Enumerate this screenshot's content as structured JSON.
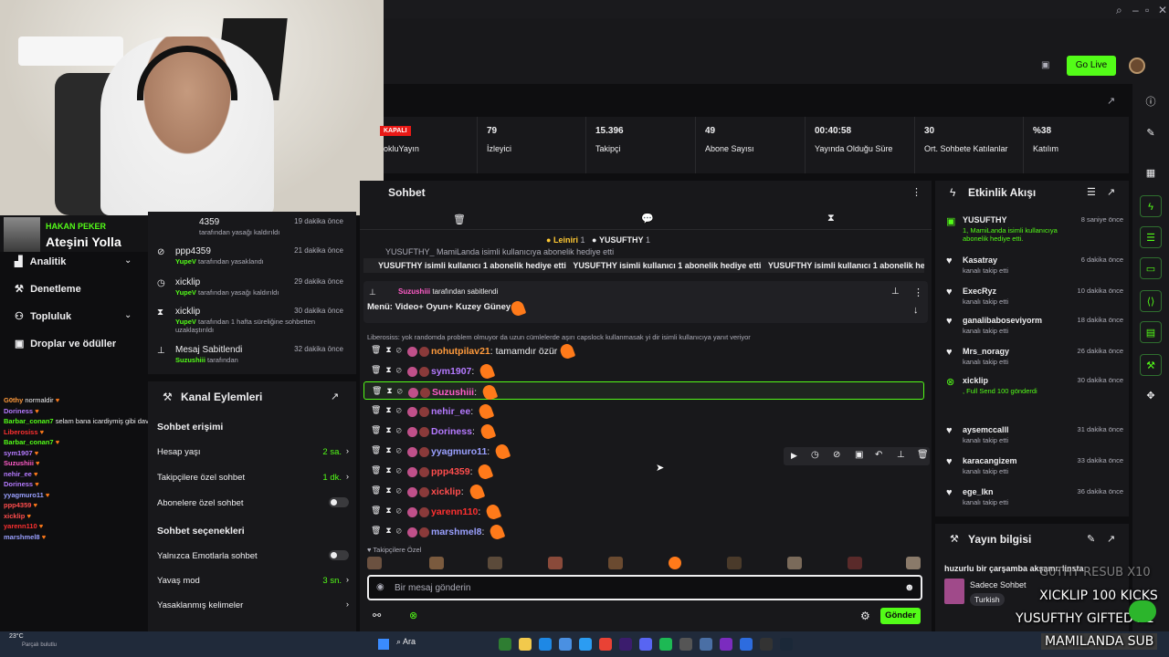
{
  "colors": {
    "accent": "#53fc18",
    "bg": "#0e0e10",
    "panel": "#18181b",
    "live": "#e91916",
    "heart": "#ff7a1a"
  },
  "header": {
    "go_live": "Go Live"
  },
  "webcam": {
    "alert_name": "HAKAN PEKER",
    "alert_message": "Ateşini Yolla"
  },
  "sidebar": {
    "items": [
      {
        "label": "Analitik",
        "icon": "chart-icon"
      },
      {
        "label": "Denetleme",
        "icon": "wrench-icon"
      },
      {
        "label": "Topluluk",
        "icon": "people-icon"
      },
      {
        "label": "Droplar ve ödüller",
        "icon": "gift-icon"
      }
    ]
  },
  "modlog": {
    "items": [
      {
        "name": "4359",
        "time": "19 dakika önce",
        "user": "",
        "text": "tarafından yasağı kaldırıldı",
        "icon": "ban-icon"
      },
      {
        "name": "ppp4359",
        "time": "21 dakika önce",
        "user": "YupeV",
        "text": "tarafından yasaklandı",
        "icon": "ban-icon"
      },
      {
        "name": "xicklip",
        "time": "29 dakika önce",
        "user": "YupeV",
        "text": "tarafından yasağı kaldırıldı",
        "icon": "clock-icon"
      },
      {
        "name": "xicklip",
        "time": "30 dakika önce",
        "user": "YupeV",
        "text": "tarafından 1 hafta süreliğine sohbetten uzaklaştırıldı",
        "icon": "hourglass-icon"
      },
      {
        "name": "Mesaj Sabitlendi",
        "time": "32 dakika önce",
        "user": "Suzushiii",
        "text": "tarafından",
        "icon": "pin-icon"
      }
    ]
  },
  "actions": {
    "title": "Kanal Eylemleri",
    "access_title": "Sohbet erişimi",
    "account_age": {
      "label": "Hesap yaşı",
      "value": "2 sa."
    },
    "followers_only": {
      "label": "Takipçilere özel sohbet",
      "value": "1 dk."
    },
    "subs_only": {
      "label": "Abonelere özel sohbet"
    },
    "options_title": "Sohbet seçenekleri",
    "emotes_only": {
      "label": "Yalnızca Emotlarla sohbet"
    },
    "slow_mode": {
      "label": "Yavaş mod",
      "value": "3 sn."
    },
    "banned_words": {
      "label": "Yasaklanmış kelimeler"
    }
  },
  "stats": {
    "live_badge": "KAPALI",
    "items": [
      {
        "value": "",
        "label": "okluYayın"
      },
      {
        "value": "79",
        "label": "İzleyici"
      },
      {
        "value": "15.396",
        "label": "Takipçi"
      },
      {
        "value": "49",
        "label": "Abone Sayısı"
      },
      {
        "value": "00:40:58",
        "label": "Yayında Olduğu Süre"
      },
      {
        "value": "30",
        "label": "Ort. Sohbete Katılanlar"
      },
      {
        "value": "%38",
        "label": "Katılım"
      }
    ]
  },
  "chat": {
    "title": "Sohbet",
    "gifters": [
      {
        "name": "Leiniri",
        "count": "1"
      },
      {
        "name": "YUSUFTHY",
        "count": "1"
      }
    ],
    "gift_banner": "YUSUFTHY isimli kullanıcı 1 abonelik hediye etti",
    "gift_banner_top": "YUSUFTHY_ MamiLanda isimli kullanıcıya abonelik hediye etti",
    "pinned_by": "Suzushiii",
    "pinned_by_text": "tarafından sabitlendi",
    "pinned_message": "Menü: Video+ Oyun+ Kuzey Güney",
    "reply_note": "Liberosiss: yok randomda problem olmuyor da uzun cümlelerde aşırı capslock kullanmasak yi dir isimli kullanıcıya yanıt veriyor",
    "messages": [
      {
        "user": "nohutpilav21",
        "color": "#ff9a3c",
        "text": "tamamdır özür"
      },
      {
        "user": "sym1907",
        "color": "#b57aff",
        "text": ""
      },
      {
        "user": "Suzushiii",
        "color": "#ff5cc8",
        "text": ""
      },
      {
        "user": "nehir_ee",
        "color": "#b57aff",
        "text": ""
      },
      {
        "user": "Doriness",
        "color": "#b57aff",
        "text": ""
      },
      {
        "user": "yyagmuro11",
        "color": "#9aa0ff",
        "text": ""
      },
      {
        "user": "ppp4359",
        "color": "#ff4d4d",
        "text": ""
      },
      {
        "user": "xicklip",
        "color": "#ff4d4d",
        "text": ""
      },
      {
        "user": "yarenn110",
        "color": "#ff3030",
        "text": ""
      },
      {
        "user": "marshmel8",
        "color": "#9aa0ff",
        "text": ""
      }
    ],
    "followers_only_note": "Takipçilere Özel",
    "input_placeholder": "Bir mesaj gönderin",
    "send": "Gönder"
  },
  "feed": {
    "title": "Etkinlik Akışı",
    "items": [
      {
        "name": "YUSUFTHY",
        "time": "8 saniye önce",
        "detail": "1, MamiLanda isimli kullanıcıya abonelik hediye etti.",
        "icon": "gift-icon"
      },
      {
        "name": "Kasatray",
        "time": "6 dakika önce",
        "detail": "kanalı takip etti",
        "icon": "heart-icon"
      },
      {
        "name": "ExecRyz",
        "time": "10 dakika önce",
        "detail": "kanalı takip etti",
        "icon": "heart-icon"
      },
      {
        "name": "ganalibaboseviyorm",
        "time": "18 dakika önce",
        "detail": "kanalı takip etti",
        "icon": "heart-icon"
      },
      {
        "name": "Mrs_noragy",
        "time": "26 dakika önce",
        "detail": "kanalı takip etti",
        "icon": "heart-icon"
      },
      {
        "name": "xicklip",
        "time": "30 dakika önce",
        "detail": ", Full Send 100 gönderdi",
        "icon": "kick-icon"
      },
      {
        "name": "aysemccalll",
        "time": "31 dakika önce",
        "detail": "kanalı takip etti",
        "icon": "heart-icon"
      },
      {
        "name": "karacangizem",
        "time": "33 dakika önce",
        "detail": "kanalı takip etti",
        "icon": "heart-icon"
      },
      {
        "name": "ege_lkn",
        "time": "36 dakika önce",
        "detail": "kanalı takip etti",
        "icon": "heart-icon"
      }
    ]
  },
  "info": {
    "title": "Yayın bilgisi",
    "stream_title": "huzurlu bir çarşamba akşamı. linsta",
    "category": "Sadece Sohbet",
    "tag": "Turkish"
  },
  "overlay": {
    "line1": "G0THY  RESUB X10",
    "line2": "XICKLIP  100 KICKS",
    "line3": "YUSUFTHY  GIFTED X1",
    "line4": "MAMILANDA  SUB"
  },
  "overlay_chat": [
    {
      "user": "G0thy",
      "text": "normaldir",
      "color": "#ff9a3c"
    },
    {
      "user": "Doriness",
      "text": "",
      "color": "#b57aff"
    },
    {
      "user": "Barbar_conan7",
      "text": "selam bana icardiymiş gibi davran",
      "color": "#53fc18"
    },
    {
      "user": "Liberosiss",
      "text": "",
      "color": "#ff3030"
    },
    {
      "user": "Barbar_conan7",
      "text": "",
      "color": "#53fc18"
    },
    {
      "user": "sym1907",
      "text": "",
      "color": "#b57aff"
    },
    {
      "user": "Suzushiii",
      "text": "",
      "color": "#ff5cc8"
    },
    {
      "user": "nehir_ee",
      "text": "",
      "color": "#b57aff"
    },
    {
      "user": "Doriness",
      "text": "",
      "color": "#b57aff"
    },
    {
      "user": "yyagmuro11",
      "text": "",
      "color": "#9aa0ff"
    },
    {
      "user": "ppp4359",
      "text": "",
      "color": "#ff4d4d"
    },
    {
      "user": "xicklip",
      "text": "",
      "color": "#ff4d4d"
    },
    {
      "user": "yarenn110",
      "text": "",
      "color": "#ff3030"
    },
    {
      "user": "marshmel8",
      "text": "",
      "color": "#9aa0ff"
    }
  ],
  "taskbar": {
    "weather_temp": "23°C",
    "weather_text": "Parçalı bulutlu",
    "search": "Ara"
  }
}
